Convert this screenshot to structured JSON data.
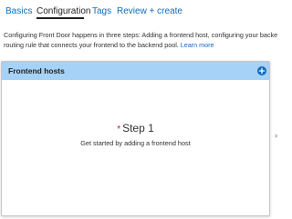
{
  "tabs": [
    {
      "label": "Basics"
    },
    {
      "label": "Configuration"
    },
    {
      "label": "Tags"
    },
    {
      "label": "Review + create"
    }
  ],
  "active_tab": "Configuration",
  "description": {
    "line1": "Configuring Front Door happens in three steps: Adding a frontend host, configuring your backends in",
    "line2": "routing rule that connects your frontend to the backend pool.",
    "link": "Learn more"
  },
  "panel": {
    "title": "Frontend hosts",
    "required_marker": "*",
    "step_label": "Step 1",
    "step_description": "Get started by adding a frontend host"
  },
  "colors": {
    "accent": "#0f6cbd",
    "panel_header": "#a5d2f6",
    "required": "#a4262c"
  },
  "icons": {
    "add": "add-circle-icon",
    "edge": "chevron-right-icon"
  }
}
